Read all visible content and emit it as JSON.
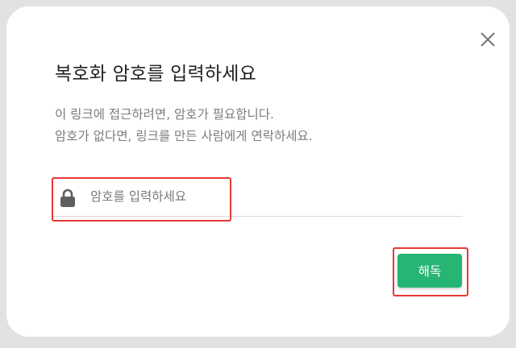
{
  "dialog": {
    "title": "복호화 암호를 입력하세요",
    "description_lines": [
      "이 링크에 접근하려면, 암호가 필요합니다.",
      "암호가 없다면, 링크를 만든 사람에게 연락하세요."
    ],
    "password": {
      "value": "",
      "placeholder": "암호를 입력하세요",
      "icon": "lock-icon"
    },
    "decrypt_button": {
      "label": "해독",
      "color": "#27b573"
    },
    "close_icon": "close-icon"
  },
  "colors": {
    "backdrop": "#e2e2e2",
    "dialog_background": "#ffffff",
    "title_text": "#222222",
    "secondary_text": "#7c7c7c",
    "highlight_box": "#e53935"
  }
}
